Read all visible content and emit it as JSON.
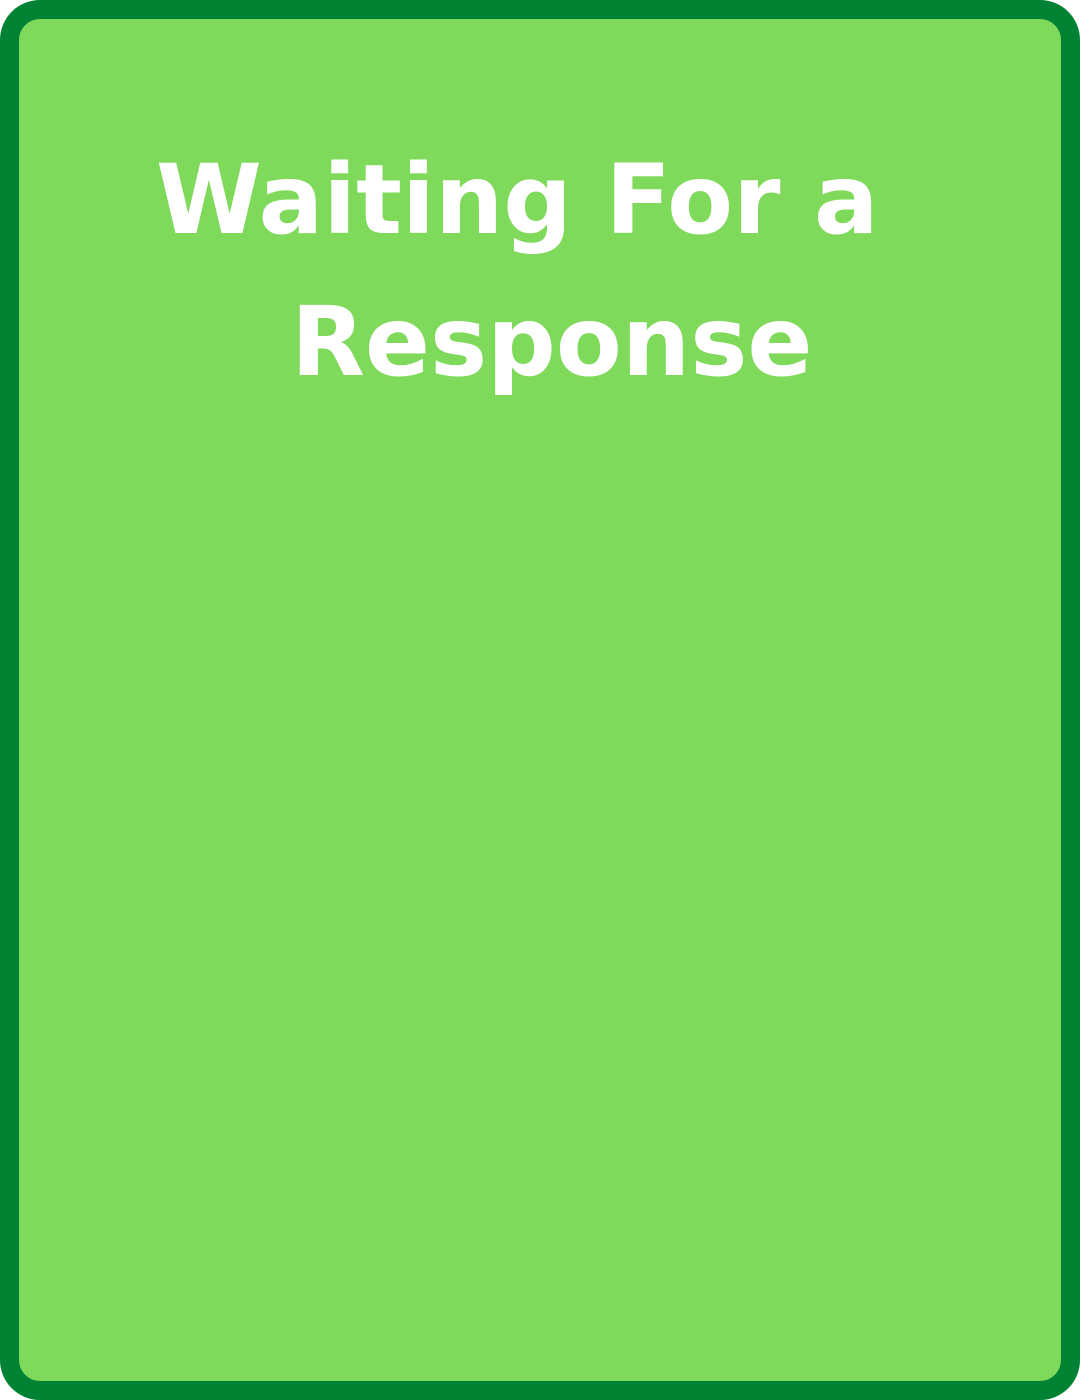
{
  "card": {
    "title_lines": [
      "Waiting For a",
      "Response"
    ]
  },
  "colors": {
    "background": "#7fd95a",
    "border": "#008234",
    "text": "#ffffff"
  }
}
